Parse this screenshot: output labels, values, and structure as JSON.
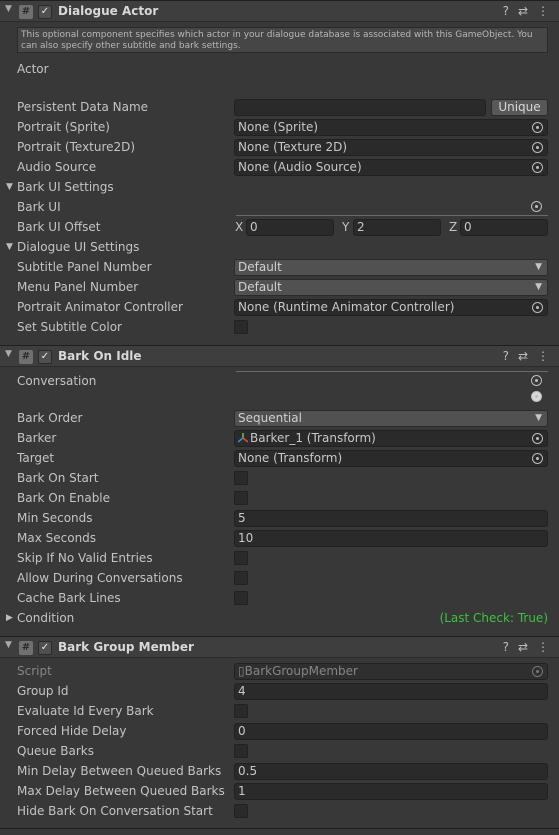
{
  "dialogue_actor": {
    "title": "Dialogue Actor",
    "help_text": "This optional component specifies which actor in your dialogue database is associated with this GameObject. You can also specify other subtitle and bark settings.",
    "actor_label": "Actor",
    "persistent_data_name_label": "Persistent Data Name",
    "persistent_data_name_value": "",
    "unique_button": "Unique",
    "portrait_sprite_label": "Portrait (Sprite)",
    "portrait_sprite_value": "None (Sprite)",
    "portrait_texture_label": "Portrait (Texture2D)",
    "portrait_texture_value": "None (Texture 2D)",
    "audio_source_label": "Audio Source",
    "audio_source_value": "None (Audio Source)",
    "bark_ui_settings_label": "Bark UI Settings",
    "bark_ui_label": "Bark UI",
    "bark_ui_offset_label": "Bark UI Offset",
    "offset": {
      "x_label": "X",
      "x": "0",
      "y_label": "Y",
      "y": "2",
      "z_label": "Z",
      "z": "0"
    },
    "dialogue_ui_settings_label": "Dialogue UI Settings",
    "subtitle_panel_label": "Subtitle Panel Number",
    "subtitle_panel_value": "Default",
    "menu_panel_label": "Menu Panel Number",
    "menu_panel_value": "Default",
    "portrait_animator_label": "Portrait Animator Controller",
    "portrait_animator_value": "None (Runtime Animator Controller)",
    "set_subtitle_color_label": "Set Subtitle Color"
  },
  "bark_on_idle": {
    "title": "Bark On Idle",
    "conversation_label": "Conversation",
    "bark_order_label": "Bark Order",
    "bark_order_value": "Sequential",
    "barker_label": "Barker",
    "barker_value": "Barker_1 (Transform)",
    "target_label": "Target",
    "target_value": "None (Transform)",
    "bark_on_start_label": "Bark On Start",
    "bark_on_enable_label": "Bark On Enable",
    "min_seconds_label": "Min Seconds",
    "min_seconds_value": "5",
    "max_seconds_label": "Max Seconds",
    "max_seconds_value": "10",
    "skip_if_no_valid_label": "Skip If No Valid Entries",
    "allow_during_conv_label": "Allow During Conversations",
    "cache_bark_lines_label": "Cache Bark Lines",
    "condition_label": "Condition",
    "last_check": "(Last Check: True)"
  },
  "bark_group_member": {
    "title": "Bark Group Member",
    "script_label": "Script",
    "script_value": "BarkGroupMember",
    "group_id_label": "Group Id",
    "group_id_value": "4",
    "evaluate_id_label": "Evaluate Id Every Bark",
    "forced_hide_label": "Forced Hide Delay",
    "forced_hide_value": "0",
    "queue_barks_label": "Queue Barks",
    "min_delay_label": "Min Delay Between Queued Barks",
    "min_delay_value": "0.5",
    "max_delay_label": "Max Delay Between Queued Barks",
    "max_delay_value": "1",
    "hide_on_conv_label": "Hide Bark On Conversation Start"
  },
  "header_icons": [
    "help-icon",
    "preset-icon",
    "more-icon"
  ],
  "colors": {
    "background": "#383838",
    "field": "#2a2a2a",
    "condition_text": "#39c23d"
  }
}
